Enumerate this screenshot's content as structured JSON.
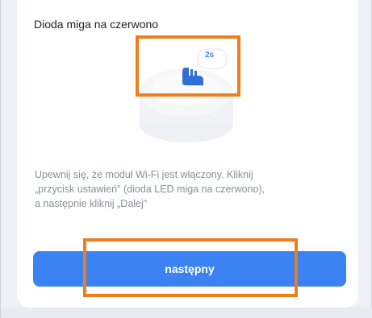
{
  "screen": {
    "title": "Dioda miga na czerwono",
    "timer_badge": "2s",
    "description_lines": [
      "Upewnij się, że moduł Wi-Fi jest włączony. Kliknij",
      "„przycisk ustawień\" (dioda LED miga na czerwono),",
      "a następnie kliknij „Dalej\""
    ],
    "next_button_label": "następny"
  },
  "colors": {
    "button": "#3b82f2",
    "highlight": "#ee7d1c",
    "description_text": "#8a8f96"
  },
  "icons": {
    "hand": "hand-press-icon",
    "device": "wifi-module-device"
  }
}
